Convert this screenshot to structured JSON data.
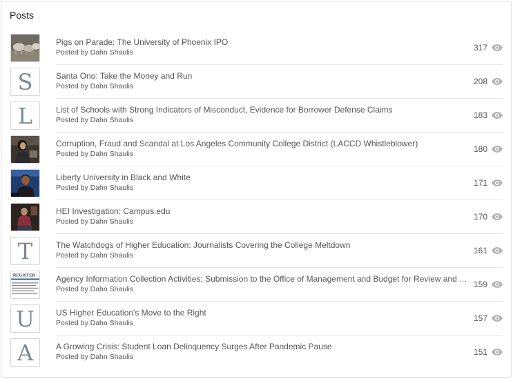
{
  "panel": {
    "title": "Posts"
  },
  "posts": [
    {
      "title": "Pigs on Parade: The University of Phoenix IPO",
      "author": "Posted by Dahn Shaulis",
      "views": "317",
      "thumb": "photo",
      "thumb_subject": "pigs"
    },
    {
      "title": "Santa Ono: Take the Money and Run",
      "author": "Posted by Dahn Shaulis",
      "views": "208",
      "thumb": "letter",
      "letter": "S"
    },
    {
      "title": "List of Schools with Strong Indicators of Misconduct, Evidence for Borrower Defense Claims",
      "author": "Posted by Dahn Shaulis",
      "views": "183",
      "thumb": "letter",
      "letter": "L"
    },
    {
      "title": "Corruption, Fraud and Scandal at Los Angeles Community College District (LACCD Whistleblower)",
      "author": "Posted by Dahn Shaulis",
      "views": "180",
      "thumb": "photo",
      "thumb_subject": "woman-speaking"
    },
    {
      "title": "Liberty University in Black and White",
      "author": "Posted by Dahn Shaulis",
      "views": "171",
      "thumb": "photo",
      "thumb_subject": "man-portrait"
    },
    {
      "title": "HEI Investigation: Campus.edu",
      "author": "Posted by Dahn Shaulis",
      "views": "170",
      "thumb": "photo",
      "thumb_subject": "person-seated"
    },
    {
      "title": "The Watchdogs of Higher Education: Journalists Covering the College Meltdown",
      "author": "Posted by Dahn Shaulis",
      "views": "161",
      "thumb": "letter",
      "letter": "T"
    },
    {
      "title": "Agency Information Collection Activities; Submission to the Office of Management and Budget for Review and Approval",
      "author": "Posted by Dahn Shaulis",
      "views": "159",
      "thumb": "photo",
      "thumb_subject": "federal-register-document",
      "thumb_text": "REGISTER"
    },
    {
      "title": "US Higher Education's Move to the Right",
      "author": "Posted by Dahn Shaulis",
      "views": "157",
      "thumb": "letter",
      "letter": "U"
    },
    {
      "title": "A Growing Crisis: Student Loan Delinquency Surges After Pandemic Pause",
      "author": "Posted by Dahn Shaulis",
      "views": "151",
      "thumb": "letter",
      "letter": "A"
    }
  ],
  "icons": {
    "views": "eye-icon"
  },
  "colors": {
    "letter": "#7a8a93",
    "text": "#555555",
    "icon": "#b0b0b0",
    "divider": "#e6e6e6"
  }
}
